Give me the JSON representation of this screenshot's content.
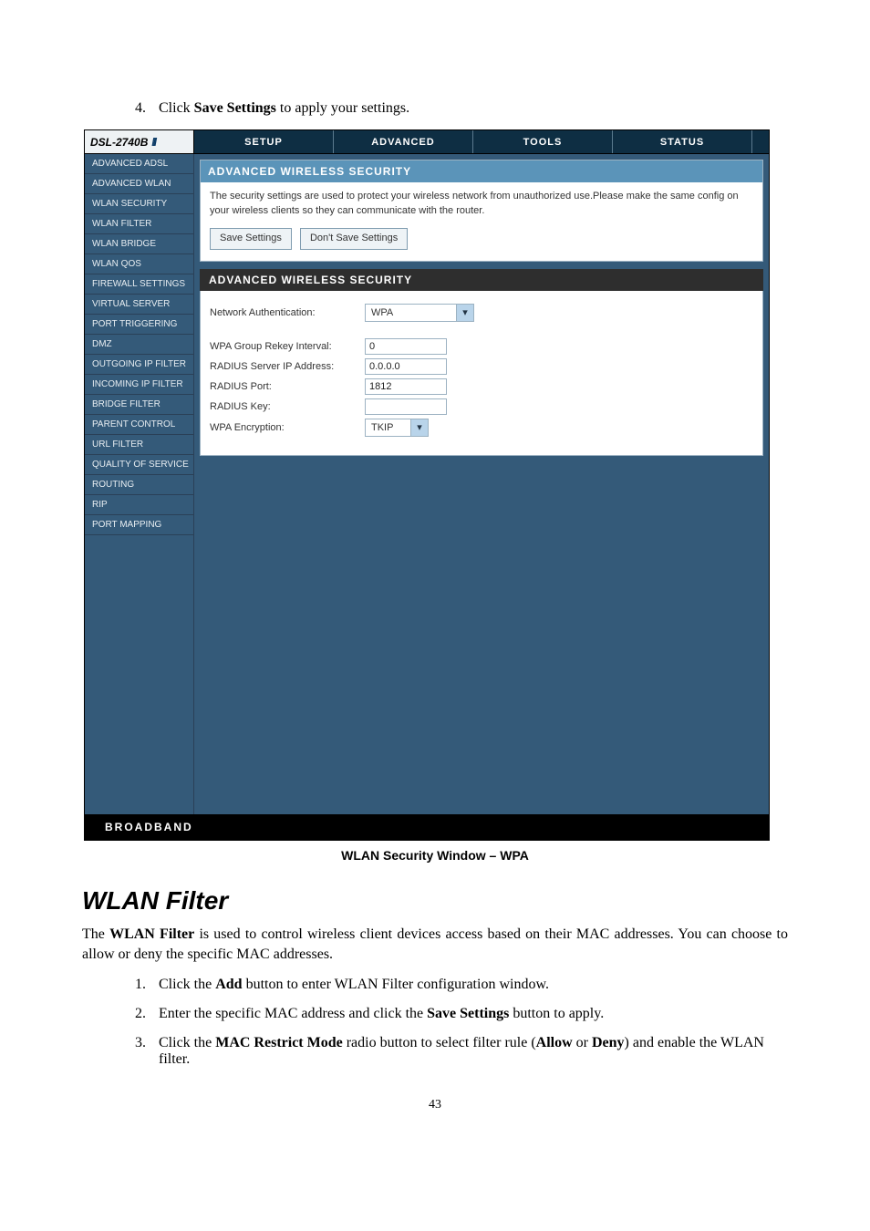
{
  "intro_step": {
    "num": "4.",
    "pre": "Click ",
    "bold": "Save Settings",
    "post": " to apply your settings."
  },
  "shot": {
    "logo": "DSL-2740B",
    "tabs": [
      "SETUP",
      "ADVANCED",
      "TOOLS",
      "STATUS"
    ],
    "side_items": [
      "ADVANCED ADSL",
      "ADVANCED WLAN",
      "WLAN SECURITY",
      "WLAN FILTER",
      "WLAN BRIDGE",
      "WLAN QOS",
      "FIREWALL SETTINGS",
      "VIRTUAL SERVER",
      "PORT TRIGGERING",
      "DMZ",
      "OUTGOING IP FILTER",
      "INCOMING IP FILTER",
      "BRIDGE FILTER",
      "PARENT CONTROL",
      "URL FILTER",
      "QUALITY OF SERVICE",
      "ROUTING",
      "RIP",
      "PORT MAPPING"
    ],
    "panel_title": "ADVANCED WIRELESS SECURITY",
    "panel_desc": "The security settings are used to protect your wireless network from unauthorized use.Please make the same config on your wireless clients so they can communicate with the router.",
    "btn_save": "Save Settings",
    "btn_dont": "Don't Save Settings",
    "subhdr": "ADVANCED WIRELESS SECURITY",
    "form": {
      "net_auth_label": "Network Authentication:",
      "net_auth_value": "WPA",
      "rekey_label": "WPA Group Rekey Interval:",
      "rekey_value": "0",
      "radius_ip_label": "RADIUS Server IP Address:",
      "radius_ip_value": "0.0.0.0",
      "radius_port_label": "RADIUS Port:",
      "radius_port_value": "1812",
      "radius_key_label": "RADIUS Key:",
      "radius_key_value": "",
      "wpa_enc_label": "WPA Encryption:",
      "wpa_enc_value": "TKIP"
    },
    "footer": "BROADBAND"
  },
  "caption": "WLAN Security Window – WPA",
  "section_title": "WLAN Filter",
  "para": {
    "pre": "The ",
    "b1": "WLAN Filter",
    "post": " is used to control wireless client devices access based on their MAC addresses.  You can choose to allow or deny the specific MAC addresses."
  },
  "steps": [
    {
      "num": "1.",
      "pre": "Click the ",
      "b": "Add",
      "post": " button to enter WLAN Filter configuration window."
    },
    {
      "num": "2.",
      "pre": "Enter the specific MAC address and click the ",
      "b": "Save Settings",
      "post": " button to apply."
    },
    {
      "num": "3.",
      "pre": "Click the ",
      "b": "MAC Restrict Mode",
      "mid": " radio button to select filter rule (",
      "b2": "Allow",
      "mid2": " or ",
      "b3": "Deny",
      "post": ") and enable the WLAN filter."
    }
  ],
  "pagenum": "43"
}
